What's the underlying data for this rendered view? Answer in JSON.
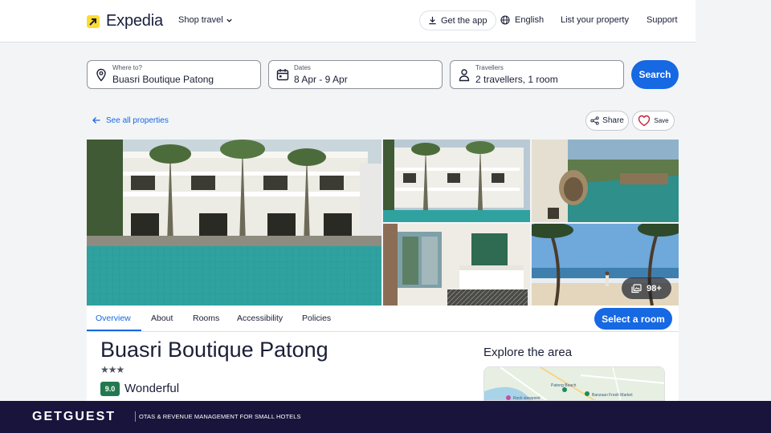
{
  "header": {
    "logo_text": "Expedia",
    "shop_travel": "Shop travel",
    "get_app": "Get the app",
    "language": "English",
    "list_property": "List your property",
    "support": "Support"
  },
  "search": {
    "destination_label": "Where to?",
    "destination_value": "Buasri Boutique Patong",
    "dates_label": "Dates",
    "dates_value": "8 Apr - 9 Apr",
    "travellers_label": "Travellers",
    "travellers_value": "2 travellers, 1 room",
    "search_button": "Search"
  },
  "actions": {
    "see_all": "See all properties",
    "share": "Share",
    "save": "Save"
  },
  "gallery": {
    "more_count": "98+"
  },
  "tabs": [
    {
      "label": "Overview",
      "active": true
    },
    {
      "label": "About",
      "active": false
    },
    {
      "label": "Rooms",
      "active": false
    },
    {
      "label": "Accessibility",
      "active": false
    },
    {
      "label": "Policies",
      "active": false
    }
  ],
  "select_room": "Select a room",
  "hotel": {
    "name": "Buasri Boutique Patong",
    "stars": "★★★",
    "rating": "9.0",
    "rating_text": "Wonderful"
  },
  "explore": {
    "title": "Explore the area",
    "map_labels": [
      "Patong Beach",
      "Rock viewpoint",
      "Banzaan Fresh Market"
    ]
  },
  "footer": {
    "brand": "GETGUEST",
    "tagline": "OTAS & REVENUE MANAGEMENT FOR SMALL HOTELS"
  },
  "colors": {
    "accent": "#1668e3",
    "brand_yellow": "#fddb32",
    "rating_green": "#227950",
    "footer_bg": "#18143c"
  }
}
